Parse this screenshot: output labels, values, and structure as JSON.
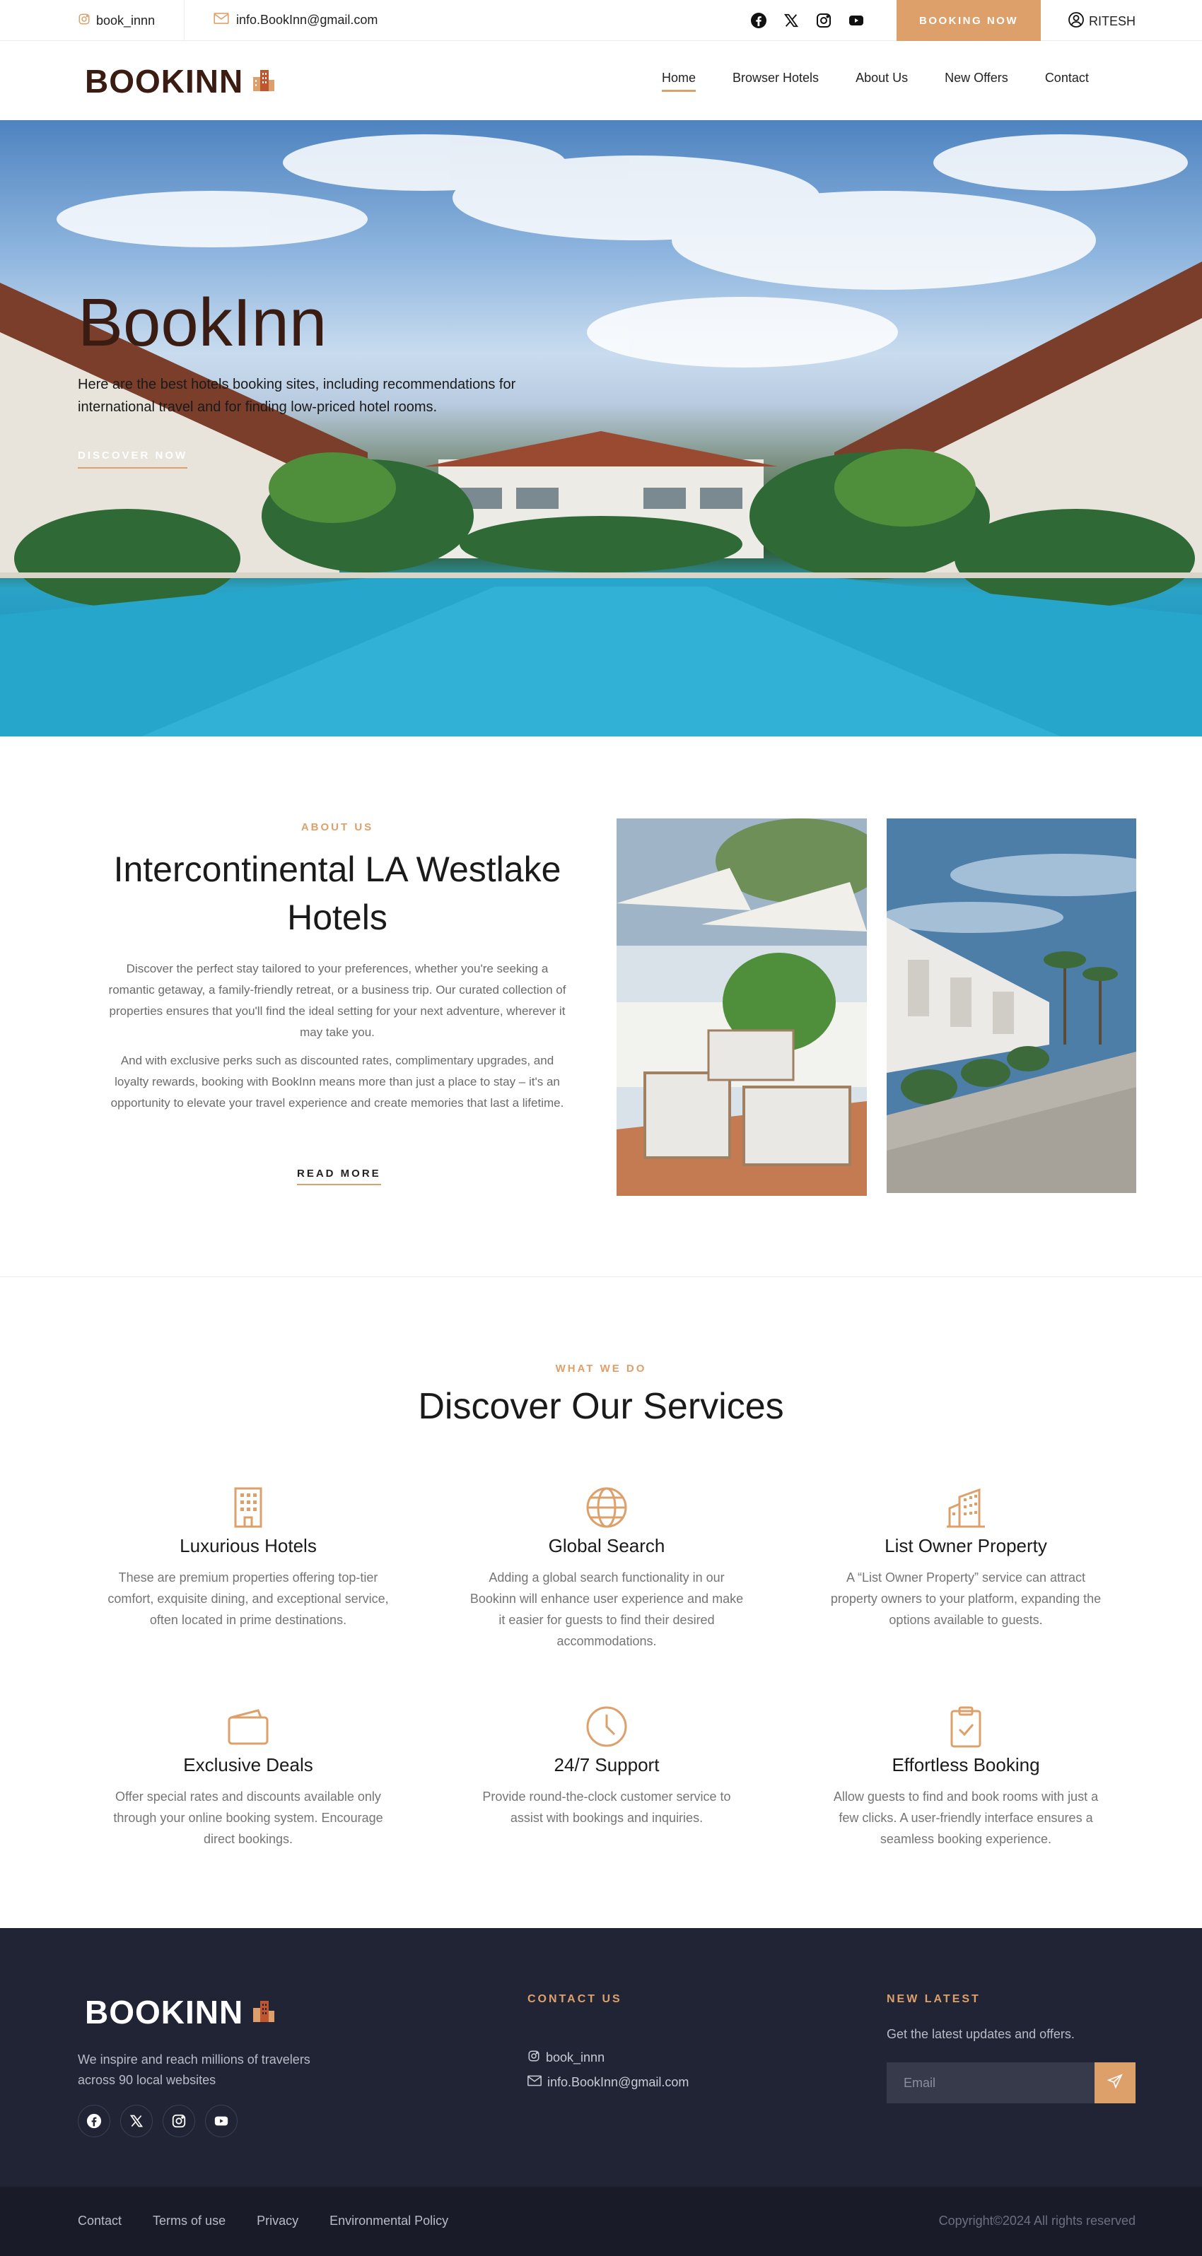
{
  "topbar": {
    "instagram_handle": "book_innn",
    "email": "info.BookInn@gmail.com",
    "socials": [
      "facebook-icon",
      "x-icon",
      "instagram-icon",
      "youtube-icon"
    ],
    "booking_button": "BOOKING NOW",
    "user_name": "RITESH"
  },
  "nav": {
    "logo": "BOOKINN",
    "links": [
      "Home",
      "Browser Hotels",
      "About Us",
      "New Offers",
      "Contact"
    ],
    "active": "Home"
  },
  "hero": {
    "title": "BookInn",
    "text": "Here are the best hotels booking sites, including recommendations for international travel and for finding low-priced hotel rooms.",
    "cta": "DISCOVER NOW"
  },
  "about": {
    "tag": "ABOUT US",
    "title": "Intercontinental LA Westlake Hotels",
    "p1": "Discover the perfect stay tailored to your preferences, whether you're seeking a romantic getaway, a family-friendly retreat, or a business trip. Our curated collection of properties ensures that you'll find the ideal setting for your next adventure, wherever it may take you.",
    "p2": "And with exclusive perks such as discounted rates, complimentary upgrades, and loyalty rewards, booking with BookInn means more than just a place to stay – it's an opportunity to elevate your travel experience and create memories that last a lifetime.",
    "cta": "READ MORE"
  },
  "services": {
    "tag": "WHAT WE DO",
    "title": "Discover Our Services",
    "items": [
      {
        "icon": "building-icon",
        "title": "Luxurious Hotels",
        "text": "These are premium properties offering top-tier comfort, exquisite dining, and exceptional service, often located in prime destinations."
      },
      {
        "icon": "globe-icon",
        "title": "Global Search",
        "text": "Adding a global search functionality in our Bookinn will enhance user experience and make it easier for guests to find their desired accommodations."
      },
      {
        "icon": "buildings-icon",
        "title": "List Owner Property",
        "text": "A “List Owner Property” service can attract property owners to your platform, expanding the options available to guests."
      },
      {
        "icon": "wallet-icon",
        "title": "Exclusive Deals",
        "text": "Offer special rates and discounts available only through your online booking system. Encourage direct bookings."
      },
      {
        "icon": "clock-icon",
        "title": "24/7 Support",
        "text": "Provide round-the-clock customer service to assist with bookings and inquiries."
      },
      {
        "icon": "clipboard-check-icon",
        "title": "Effortless Booking",
        "text": "Allow guests to find and book rooms with just a few clicks. A user-friendly interface ensures a seamless booking experience."
      }
    ]
  },
  "footer": {
    "logo": "BOOKINN",
    "description": "We inspire and reach millions of travelers across 90 local websites",
    "contact_heading": "CONTACT US",
    "instagram_handle": "book_innn",
    "email": "info.BookInn@gmail.com",
    "latest_heading": "NEW LATEST",
    "latest_text": "Get the latest updates and offers.",
    "email_placeholder": "Email",
    "bottom_links": [
      "Contact",
      "Terms of use",
      "Privacy",
      "Environmental Policy"
    ],
    "copyright": "Copyright©2024 All rights reserved"
  },
  "colors": {
    "accent": "#dea06a",
    "brand_dark": "#3a1c13",
    "footer_bg": "#202434",
    "footer_bottom_bg": "#191c28"
  }
}
